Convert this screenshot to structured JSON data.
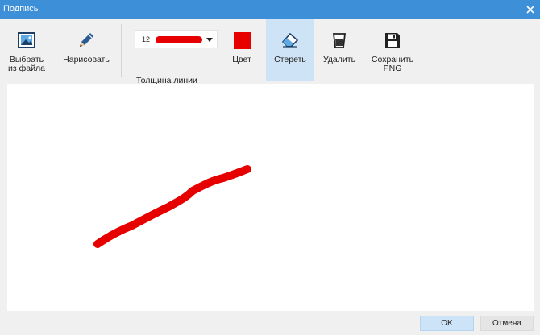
{
  "window": {
    "title": "Подпись",
    "close_icon": "close-icon"
  },
  "toolbar": {
    "from_file_label": "Выбрать\nиз файла",
    "draw_label": "Нарисовать",
    "thickness": {
      "value": "12",
      "label": "Толщина линии"
    },
    "color_label": "Цвет",
    "erase_label": "Стереть",
    "delete_label": "Удалить",
    "save_label": "Сохранить\nPNG"
  },
  "colors": {
    "pen": "#e60000",
    "accent": "#3d8fd8",
    "active_tool": "#cfe3f6"
  },
  "buttons": {
    "ok": "OK",
    "cancel": "Отмена"
  }
}
